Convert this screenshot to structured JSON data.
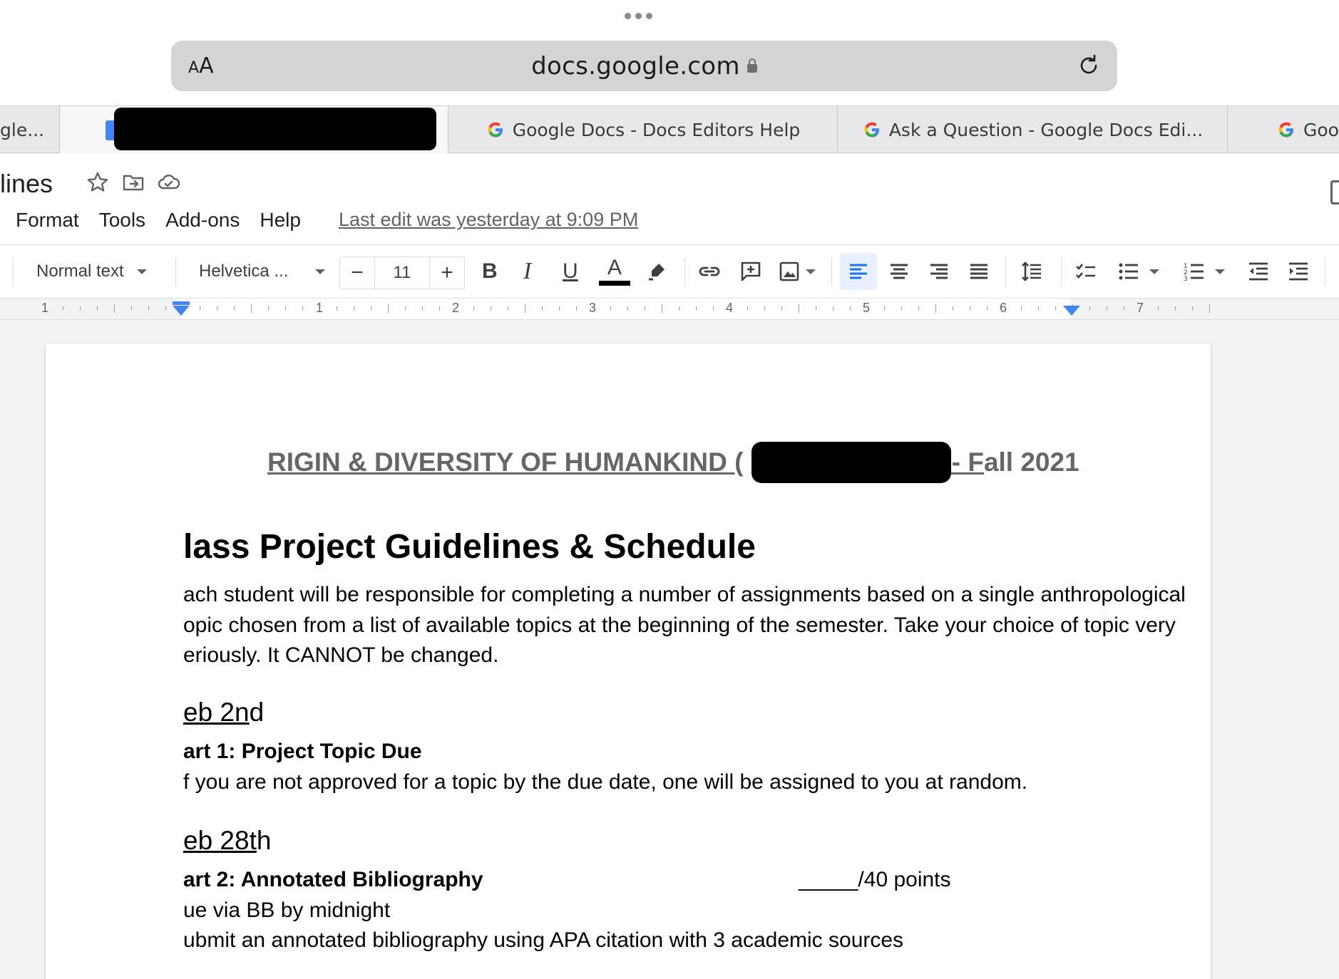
{
  "browser": {
    "text_size_button": "AA",
    "url": "docs.google.com",
    "tabs": [
      {
        "title": "gle..."
      },
      {
        "title": ""
      },
      {
        "title": "Google Docs - Docs Editors Help"
      },
      {
        "title": "Ask a Question - Google Docs Edi..."
      },
      {
        "title": "Goo"
      }
    ]
  },
  "docs": {
    "title": "lines",
    "menu": [
      "Format",
      "Tools",
      "Add-ons",
      "Help"
    ],
    "last_edit": "Last edit was yesterday at 9:09 PM"
  },
  "toolbar": {
    "style": "Normal text",
    "font": "Helvetica ...",
    "font_size": "11",
    "minus": "−",
    "plus": "+",
    "bold": "B",
    "italic": "I",
    "underline": "U",
    "text_color": "A",
    "text_color_value": "#000000"
  },
  "ruler": {
    "numbers": [
      "1",
      "1",
      "2",
      "3",
      "4",
      "5",
      "6",
      "7"
    ]
  },
  "document": {
    "course_heading_part1": "RIGIN & DIVERSITY OF HUMANKIND (",
    "course_heading_part2": ")- F",
    "course_heading_part3": "all 2021",
    "title": "lass Project Guidelines & Schedule",
    "intro_lines": [
      "ach student will be responsible for completing a number of assignments based on a single anthropological",
      "opic chosen from a list of available topics at the beginning of the semester. Take your choice of topic very",
      "eriously. It CANNOT be changed."
    ],
    "section1": {
      "date_main": "eb 2n",
      "date_suffix": "d",
      "part": "art 1: Project Topic Due",
      "text": "f you are not approved for a topic by the due date, one will be assigned to you at random."
    },
    "section2": {
      "date_main": "eb 28t",
      "date_suffix": "h",
      "part": "art 2: Annotated Bibliography",
      "points": "_____/40 points",
      "lines": [
        "ue via BB by midnight",
        "ubmit an annotated bibliography using APA citation with 3 academic sources"
      ]
    }
  }
}
